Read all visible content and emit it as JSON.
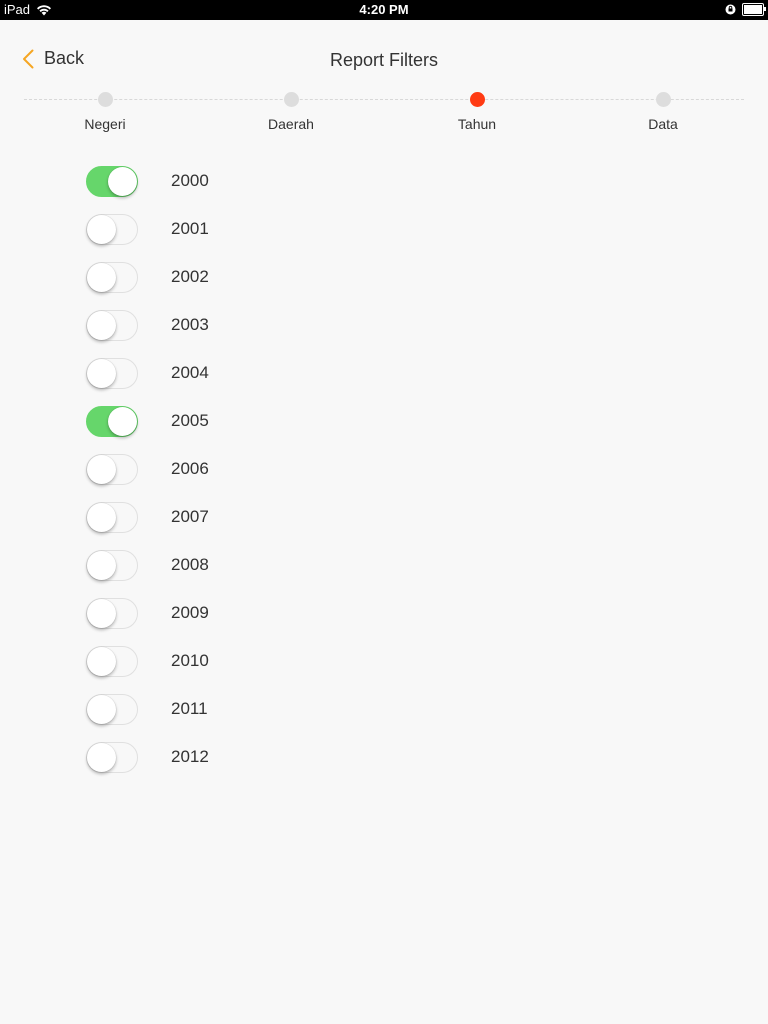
{
  "status_bar": {
    "device": "iPad",
    "time": "4:20 PM",
    "battery_level": 1.0
  },
  "nav": {
    "back_label": "Back",
    "title": "Report Filters",
    "accent_color": "#f5a623"
  },
  "steps": {
    "items": [
      {
        "label": "Negeri",
        "active": false
      },
      {
        "label": "Daerah",
        "active": false
      },
      {
        "label": "Tahun",
        "active": true
      },
      {
        "label": "Data",
        "active": false
      }
    ],
    "active_color": "#ff3b13",
    "inactive_color": "#dddddd"
  },
  "years": [
    {
      "label": "2000",
      "on": true
    },
    {
      "label": "2001",
      "on": false
    },
    {
      "label": "2002",
      "on": false
    },
    {
      "label": "2003",
      "on": false
    },
    {
      "label": "2004",
      "on": false
    },
    {
      "label": "2005",
      "on": true
    },
    {
      "label": "2006",
      "on": false
    },
    {
      "label": "2007",
      "on": false
    },
    {
      "label": "2008",
      "on": false
    },
    {
      "label": "2009",
      "on": false
    },
    {
      "label": "2010",
      "on": false
    },
    {
      "label": "2011",
      "on": false
    },
    {
      "label": "2012",
      "on": false
    }
  ],
  "toggle_on_color": "#66d66b"
}
